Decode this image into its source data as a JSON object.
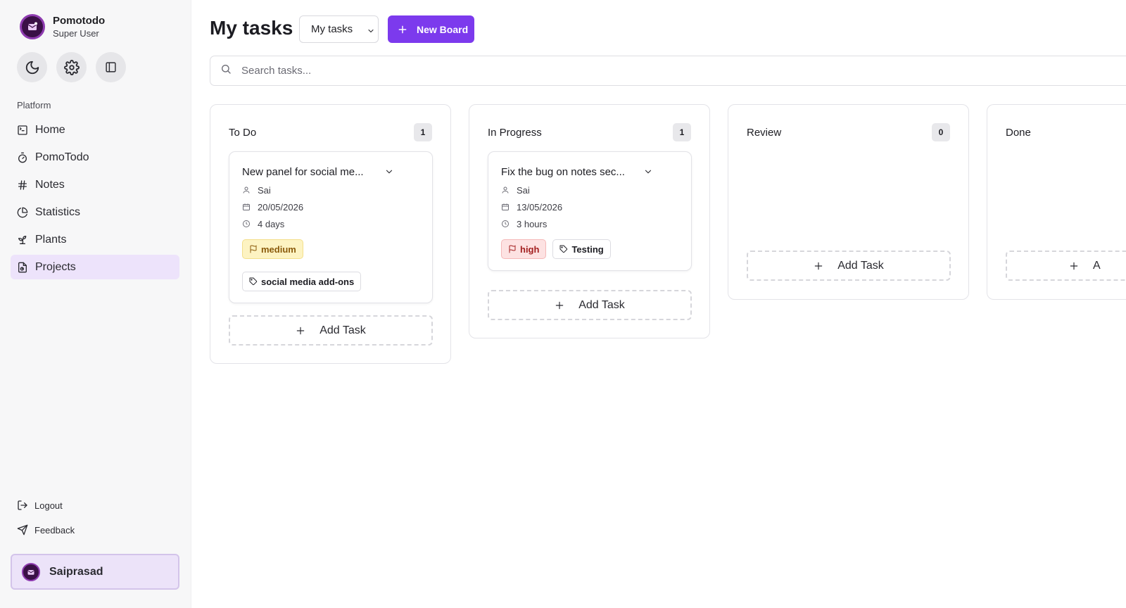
{
  "app": {
    "name": "Pomotodo",
    "role": "Super User"
  },
  "sidebar": {
    "section_label": "Platform",
    "items": [
      {
        "label": "Home",
        "icon": "terminal-square-icon"
      },
      {
        "label": "PomoTodo",
        "icon": "timer-icon"
      },
      {
        "label": "Notes",
        "icon": "hash-icon"
      },
      {
        "label": "Statistics",
        "icon": "pie-chart-icon"
      },
      {
        "label": "Plants",
        "icon": "sprout-icon"
      },
      {
        "label": "Projects",
        "icon": "file-chart-icon",
        "active": true
      }
    ],
    "logout": "Logout",
    "feedback": "Feedback",
    "user": "Saiprasad"
  },
  "header": {
    "title": "My tasks",
    "board_select": "My tasks",
    "new_board": "New Board"
  },
  "search": {
    "placeholder": "Search tasks..."
  },
  "columns": [
    {
      "title": "To Do",
      "count": "1",
      "tasks": [
        {
          "title": "New panel for social me...",
          "assignee": "Sai",
          "date": "20/05/2026",
          "duration": "4 days",
          "priority": "medium",
          "labels": [
            "social media add-ons"
          ]
        }
      ]
    },
    {
      "title": "In Progress",
      "count": "1",
      "tasks": [
        {
          "title": "Fix the bug on notes sec...",
          "assignee": "Sai",
          "date": "13/05/2026",
          "duration": "3 hours",
          "priority": "high",
          "labels": [
            "Testing"
          ]
        }
      ]
    },
    {
      "title": "Review",
      "count": "0",
      "tasks": []
    },
    {
      "title": "Done",
      "count": "",
      "tasks": []
    }
  ],
  "add_task_label": "Add Task",
  "add_task_partial": "A",
  "colors": {
    "accent": "#7c3aed",
    "active_nav": "#ede3fb",
    "priority_medium": "#fdf3c2",
    "priority_high": "#fde2e2"
  }
}
